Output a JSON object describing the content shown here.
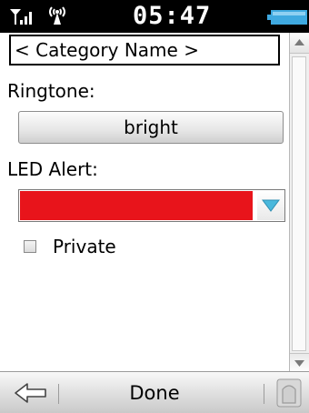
{
  "status_bar": {
    "time": "05:47",
    "icons": [
      "signal-strength-icon",
      "radio-antenna-icon",
      "battery-icon"
    ]
  },
  "form": {
    "category_name": "< Category Name >",
    "ringtone_label": "Ringtone:",
    "ringtone_value": "bright",
    "led_alert_label": "LED Alert:",
    "led_alert_color": "#e8141b",
    "private_label": "Private",
    "private_checked": false
  },
  "softkeys": {
    "back_icon": "back-arrow-icon",
    "center_label": "Done",
    "home_icon": "home-button-icon"
  },
  "colors": {
    "status_bar_bg": "#000000",
    "led_selected": "#e8141b",
    "dropdown_arrow": "#4ab8dc",
    "battery_fill": "#3fa9e0"
  }
}
